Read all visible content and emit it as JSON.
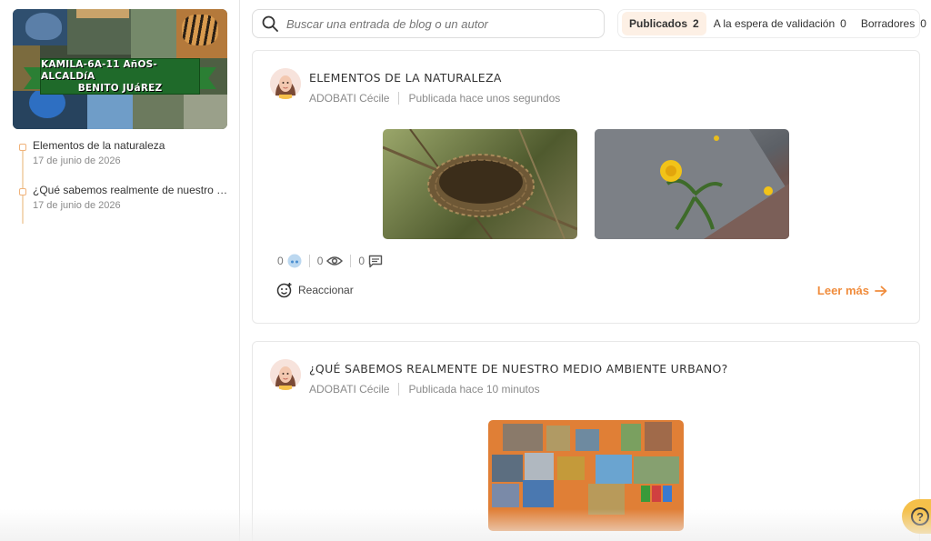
{
  "sidebar": {
    "cover": {
      "banner_line1": "KAMILA-6A-11 AñOS-ALCALDíA",
      "banner_line2": "BENITO JUáREZ"
    },
    "timeline": [
      {
        "title": "Elementos de la naturaleza",
        "date": "17 de junio de 2026"
      },
      {
        "title": "¿Qué sabemos realmente de nuestro m…",
        "date": "17 de junio de 2026"
      }
    ]
  },
  "search": {
    "placeholder": "Buscar una entrada de blog o un autor",
    "icon": "search-icon"
  },
  "tabs": [
    {
      "label": "Publicados",
      "count": "2",
      "active": true
    },
    {
      "label": "A la espera de validación",
      "count": "0",
      "active": false
    },
    {
      "label": "Borradores",
      "count": "0",
      "active": false
    }
  ],
  "posts": [
    {
      "title": "ELEMENTOS DE LA NATURALEZA",
      "author": "ADOBATI Cécile",
      "published": "Publicada hace unos segundos",
      "stats": {
        "reactions": "0",
        "views": "0",
        "comments": "0"
      },
      "react_label": "Reaccionar",
      "read_more": "Leer más"
    },
    {
      "title": "¿QUÉ SABEMOS REALMENTE DE NUESTRO MEDIO AMBIENTE URBANO?",
      "author": "ADOBATI Cécile",
      "published": "Publicada hace 10 minutos"
    }
  ],
  "colors": {
    "accent": "#f08c3c",
    "active_tab_bg": "#fdf0e5",
    "help_button": "#f5c04a",
    "left_edge": "#8bc34a"
  },
  "help": {
    "label": "?"
  }
}
